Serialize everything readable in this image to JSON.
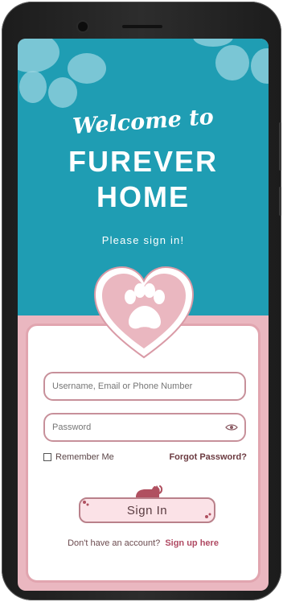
{
  "header": {
    "welcome": "Welcome to",
    "title_line1": "FUREVER",
    "title_line2": "HOME",
    "subtitle": "Please sign in!"
  },
  "form": {
    "username_placeholder": "Username, Email or Phone Number",
    "password_placeholder": "Password",
    "remember_label": "Remember Me",
    "forgot_label": "Forgot Password?",
    "signin_label": "Sign In",
    "no_account_text": "Don't have an account?",
    "signup_label": "Sign up here"
  },
  "colors": {
    "header_bg": "#1f9db3",
    "pink_bg": "#eab7c0",
    "accent_link": "#b04a63"
  }
}
